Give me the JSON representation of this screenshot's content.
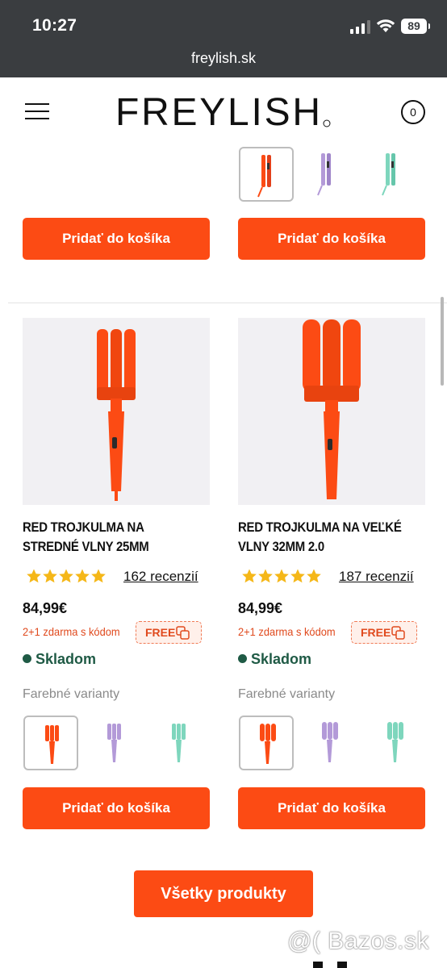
{
  "status_bar": {
    "time": "10:27",
    "battery": "89"
  },
  "browser": {
    "url": "freylish.sk"
  },
  "header": {
    "logo": "FREYLISH",
    "cart_count": "0"
  },
  "top_row": {
    "buttons": [
      "Pridať do košíka",
      "Pridať do košíka"
    ]
  },
  "products": [
    {
      "title_line1": "RED TROJKULMA NA",
      "title_line2": "STREDNÉ VLNY 25MM",
      "rating": 5,
      "reviews": "162 recenzií",
      "price": "84,99€",
      "promo": "2+1 zdarma s kódom",
      "code": "FREE",
      "stock": "Skladom",
      "variants_label": "Farebné varianty",
      "button": "Pridať do košíka"
    },
    {
      "title_line1": "RED TROJKULMA NA VEĽKÉ",
      "title_line2": "VLNY 32MM 2.0",
      "rating": 5,
      "reviews": "187 recenzií",
      "price": "84,99€",
      "promo": "2+1 zdarma s kódom",
      "code": "FREE",
      "stock": "Skladom",
      "variants_label": "Farebné varianty",
      "button": "Pridať do košíka"
    }
  ],
  "variant_colors": [
    "#fc4b14",
    "#b39ad8",
    "#7ed6bd"
  ],
  "colors": {
    "accent": "#fc4b14",
    "stock": "#1f5a45",
    "promo": "#e04a1e",
    "star": "#f5b718"
  },
  "all_products_button": "Všetky produkty",
  "watermark": "@( Bazos.sk"
}
